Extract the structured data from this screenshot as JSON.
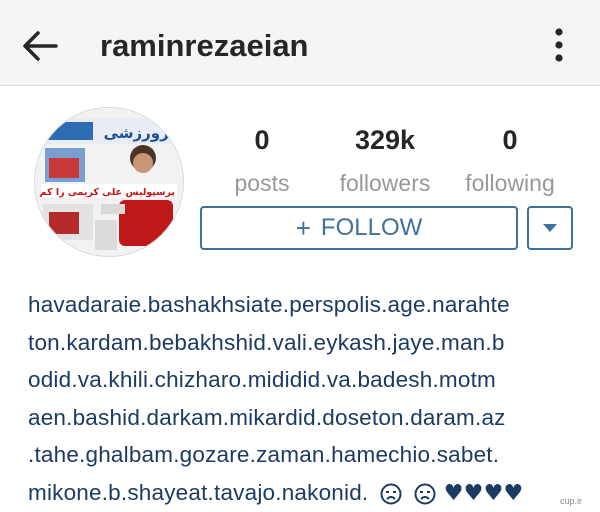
{
  "header": {
    "username": "raminrezaeian",
    "back_icon": "arrow-left-icon",
    "menu_icon": "vertical-dots-icon"
  },
  "profile": {
    "avatar_headline": "پرسپولیس علی کریمی را کم دارد",
    "avatar_masthead": "خبرورزشی",
    "stats": [
      {
        "value": "0",
        "label": "posts"
      },
      {
        "value": "329k",
        "label": "followers"
      },
      {
        "value": "0",
        "label": "following"
      }
    ],
    "follow_button": {
      "label": "FOLLOW",
      "icon": "plus-icon"
    },
    "dropdown_icon": "caret-down-icon"
  },
  "bio": {
    "lines": [
      "havadaraie.bashakhsiate.perspolis.age.narahte",
      "ton.kardam.bebakhshid.vali.eykash.jaye.man.b",
      "odid.va.khili.chizharo.mididid.va.badesh.motm",
      "aen.bashid.darkam.mikardid.doseton.daram.az",
      ".tahe.ghalbam.gozare.zaman.hamechio.sabet.",
      "mikone.b.shayeat.tavajo.nakonid."
    ],
    "emoji_trail": "♥♥♥♥"
  },
  "watermark": "cup.ir",
  "colors": {
    "accent": "#3f729b",
    "bio_text": "#1c3b63",
    "muted": "#999999",
    "header_bg": "#f5f5f5"
  }
}
